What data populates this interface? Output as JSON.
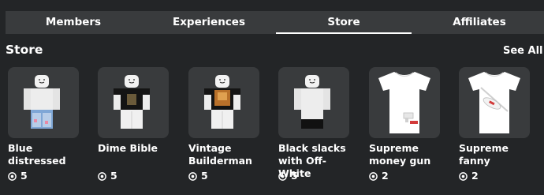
{
  "tabs": [
    {
      "label": "Members"
    },
    {
      "label": "Experiences"
    },
    {
      "label": "Store",
      "active": true
    },
    {
      "label": "Affiliates"
    }
  ],
  "store": {
    "title": "Store",
    "see_all": "See All",
    "items": [
      {
        "name": "Blue distressed",
        "price": "5",
        "icon": "avatar-blue-jeans"
      },
      {
        "name": "Dime Bible",
        "price": "5",
        "icon": "avatar-black-shirt"
      },
      {
        "name": "Vintage Builderman",
        "price": "5",
        "icon": "avatar-builderman-shirt"
      },
      {
        "name": "Black slacks with Off-White",
        "price": "5",
        "icon": "avatar-black-slacks"
      },
      {
        "name": "Supreme money gun",
        "price": "2",
        "icon": "tshirt-money-gun"
      },
      {
        "name": "Supreme fanny",
        "price": "2",
        "icon": "tshirt-fanny-pack"
      }
    ]
  },
  "colors": {
    "background": "#232527",
    "tab_bar": "#393b3d",
    "thumb_bg": "#393b3d",
    "text": "#ffffff"
  }
}
